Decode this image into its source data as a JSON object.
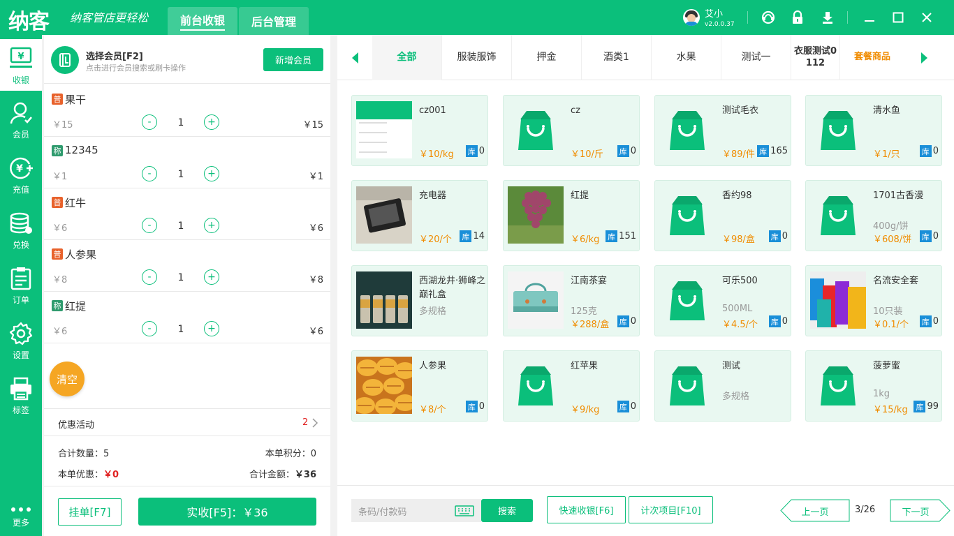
{
  "header": {
    "logo": "纳客",
    "slogan": "纳客管店更轻松",
    "tabs": [
      "前台收银",
      "后台管理"
    ],
    "user": "艾小",
    "version": "v2.0.0.37"
  },
  "sidebar": [
    {
      "label": "收银",
      "icon": "cashier-icon"
    },
    {
      "label": "会员",
      "icon": "member-icon"
    },
    {
      "label": "充值",
      "icon": "recharge-icon"
    },
    {
      "label": "兑换",
      "icon": "exchange-icon"
    },
    {
      "label": "订单",
      "icon": "order-icon"
    },
    {
      "label": "设置",
      "icon": "gear-icon"
    },
    {
      "label": "标签",
      "icon": "printer-icon"
    },
    {
      "label": "更多",
      "icon": "more-icon"
    }
  ],
  "member": {
    "title": "选择会员[F2]",
    "subtitle": "点击进行会员搜索或刷卡操作",
    "add_label": "新增会员"
  },
  "cart": [
    {
      "badge": "普",
      "badge_color": "#e8622c",
      "name": "果干",
      "price": "￥15",
      "qty_minus": "-",
      "qty": "1",
      "qty_plus": "+",
      "total": "￥15"
    },
    {
      "badge": "称",
      "badge_color": "#2f9b6e",
      "name": "12345",
      "price": "￥1",
      "qty_minus": "-",
      "qty": "1",
      "qty_plus": "+",
      "total": "￥1"
    },
    {
      "badge": "普",
      "badge_color": "#e8622c",
      "name": "红牛",
      "price": "￥6",
      "qty_minus": "-",
      "qty": "1",
      "qty_plus": "+",
      "total": "￥6"
    },
    {
      "badge": "普",
      "badge_color": "#e8622c",
      "name": "人参果",
      "price": "￥8",
      "qty_minus": "-",
      "qty": "1",
      "qty_plus": "+",
      "total": "￥8"
    },
    {
      "badge": "称",
      "badge_color": "#2f9b6e",
      "name": "红提",
      "price": "￥6",
      "qty_minus": "-",
      "qty": "1",
      "qty_plus": "+",
      "total": "￥6"
    }
  ],
  "clear_label": "清空",
  "promo": {
    "label": "优惠活动",
    "count": "2"
  },
  "summary": {
    "qty_label": "合计数量：",
    "qty": "5",
    "points_label": "本单积分：",
    "points": "0",
    "discount_label": "本单优惠：",
    "discount": "￥0",
    "total_label": "合计金额：",
    "total": "￥36"
  },
  "footer_left": {
    "hold_label": "挂单[F7]",
    "pay_label": "实收[F5]：￥36"
  },
  "categories": [
    "全部",
    "服装服饰",
    "押金",
    "酒类1",
    "水果",
    "测试一",
    "衣服测试0112",
    "套餐商品"
  ],
  "products": [
    {
      "name": "cz001",
      "spec": "",
      "price": "￥10/kg",
      "stock_badge": "库",
      "stock": "0",
      "thumb": "screenshot"
    },
    {
      "name": "cz",
      "spec": "",
      "price": "￥10/斤",
      "stock_badge": "库",
      "stock": "0",
      "thumb": "bag"
    },
    {
      "name": "测试毛衣",
      "spec": "",
      "price": "￥89/件",
      "stock_badge": "库",
      "stock": "165",
      "thumb": "bag"
    },
    {
      "name": "清水鱼",
      "spec": "",
      "price": "￥1/只",
      "stock_badge": "库",
      "stock": "0",
      "thumb": "bag"
    },
    {
      "name": "充电器",
      "spec": "",
      "price": "￥20/个",
      "stock_badge": "库",
      "stock": "14",
      "thumb": "charger"
    },
    {
      "name": "红提",
      "spec": "",
      "price": "￥6/kg",
      "stock_badge": "库",
      "stock": "151",
      "thumb": "grapes"
    },
    {
      "name": "香约98",
      "spec": "",
      "price": "￥98/盒",
      "stock_badge": "库",
      "stock": "0",
      "thumb": "bag"
    },
    {
      "name": "1701古香漫",
      "spec": "400g/饼",
      "price": "￥608/饼",
      "stock_badge": "库",
      "stock": "0",
      "thumb": "bag"
    },
    {
      "name": "西湖龙井·狮峰之巅礼盒",
      "spec": "多规格",
      "price": "",
      "stock_badge": "",
      "stock": "",
      "thumb": "tea"
    },
    {
      "name": "江南茶宴",
      "spec": "125克",
      "price": "￥288/盒",
      "stock_badge": "库",
      "stock": "0",
      "thumb": "teabox"
    },
    {
      "name": "可乐500",
      "spec": "500ML",
      "price": "￥4.5/个",
      "stock_badge": "库",
      "stock": "0",
      "thumb": "bag"
    },
    {
      "name": "名流安全套",
      "spec": "10只装",
      "price": "￥0.1/个",
      "stock_badge": "库",
      "stock": "0",
      "thumb": "boxes"
    },
    {
      "name": "人参果",
      "spec": "",
      "price": "￥8/个",
      "stock_badge": "库",
      "stock": "0",
      "thumb": "melon"
    },
    {
      "name": "红苹果",
      "spec": "",
      "price": "￥9/kg",
      "stock_badge": "库",
      "stock": "0",
      "thumb": "bag"
    },
    {
      "name": "测试",
      "spec": "多规格",
      "price": "",
      "stock_badge": "",
      "stock": "",
      "thumb": "bag"
    },
    {
      "name": "菠萝蜜",
      "spec": "1kg",
      "price": "￥15/kg",
      "stock_badge": "库",
      "stock": "99",
      "thumb": "bag"
    }
  ],
  "bottom": {
    "barcode_placeholder": "条码/付款码",
    "search_label": "搜索",
    "quick_label": "快速收银[F6]",
    "count_label": "计次项目[F10]",
    "prev_label": "上一页",
    "page": "3/26",
    "next_label": "下一页"
  },
  "colors": {
    "primary": "#0bbf7b",
    "orange": "#f08c00",
    "red": "#e02020",
    "blue": "#1a8fd8"
  }
}
